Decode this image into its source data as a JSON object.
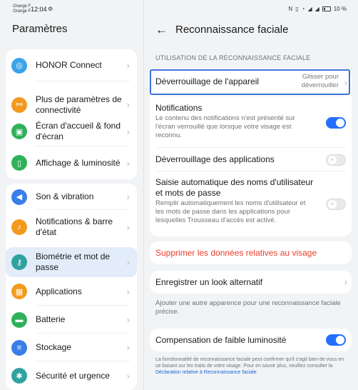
{
  "status": {
    "carrier1": "Orange F",
    "carrier2": "Orange F",
    "time": "12:04",
    "battery": "10 %"
  },
  "left": {
    "title": "Paramètres",
    "items": [
      {
        "label": "HONOR Connect",
        "icon": "honor-connect-icon",
        "color": "#3ca3e8"
      },
      {
        "label": "Plus de paramètres de connectivité",
        "icon": "link-icon",
        "color": "#f39a1e"
      },
      {
        "label": "Écran d'accueil & fond d'écran",
        "icon": "image-icon",
        "color": "#2fb15a"
      },
      {
        "label": "Affichage & luminosité",
        "icon": "phone-display-icon",
        "color": "#2fb15a"
      },
      {
        "label": "Son & vibration",
        "icon": "volume-icon",
        "color": "#3a7ee8"
      },
      {
        "label": "Notifications & barre d'état",
        "icon": "bell-icon",
        "color": "#f39a1e"
      },
      {
        "label": "Biométrie et mot de passe",
        "icon": "key-icon",
        "color": "#2fa3a0"
      },
      {
        "label": "Applications",
        "icon": "apps-icon",
        "color": "#f39a1e"
      },
      {
        "label": "Batterie",
        "icon": "battery-icon",
        "color": "#2fb15a"
      },
      {
        "label": "Stockage",
        "icon": "storage-icon",
        "color": "#3a7ee8"
      },
      {
        "label": "Sécurité et urgence",
        "icon": "asterisk-icon",
        "color": "#2fa3a0"
      }
    ]
  },
  "right": {
    "title": "Reconnaissance faciale",
    "section": "UTILISATION DE LA RECONNAISSANCE FACIALE",
    "unlock": {
      "label": "Déverrouillage de l'appareil",
      "value1": "Glisser pour",
      "value2": "déverrouiller"
    },
    "notifications": {
      "label": "Notifications",
      "desc": "Le contenu des notifications n'est présenté sur l'écran verrouillé que lorsque votre visage est reconnu.",
      "on": true
    },
    "app_unlock": {
      "label": "Déverrouillage des applications",
      "on": false
    },
    "autofill": {
      "label": "Saisie automatique des noms d'utilisateur et mots de passe",
      "desc": "Remplir automatiquement les noms d'utilisateur et les mots de passe dans les applications pour lesquelles Trousseau d'accès est activé.",
      "on": false
    },
    "delete": "Supprimer les données relatives au visage",
    "alt_look": "Enregistrer un look alternatif",
    "alt_note": "Ajouter une autre apparence pour une reconnaissance faciale précise.",
    "low_light": {
      "label": "Compensation de faible luminosité",
      "on": true
    },
    "footer": "La fonctionnalité de reconnaissance faciale peut confirmer qu'il s'agit bien de vous en se basant sur les traits de votre visage. Pour en savoir plus, veuillez consulter la ",
    "footer_link": "Déclaration relative à Reconnaissance faciale",
    "footer_end": "."
  }
}
